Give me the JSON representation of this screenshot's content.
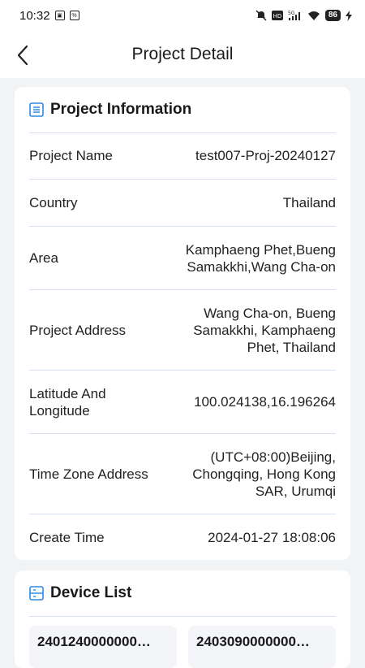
{
  "status_bar": {
    "time": "10:32",
    "battery": "86"
  },
  "header": {
    "title": "Project Detail"
  },
  "project_info": {
    "section_title": "Project Information",
    "rows": [
      {
        "label": "Project Name",
        "value": "test007-Proj-20240127"
      },
      {
        "label": "Country",
        "value": "Thailand"
      },
      {
        "label": "Area",
        "value": "Kamphaeng Phet,Bueng Samakkhi,Wang Cha-on"
      },
      {
        "label": "Project Address",
        "value": "Wang Cha-on, Bueng Samakkhi, Kamphaeng Phet, Thailand"
      },
      {
        "label": "Latitude And Longitude",
        "value": "100.024138,16.196264"
      },
      {
        "label": "Time Zone Address",
        "value": "(UTC+08:00)Beijing, Chongqing, Hong Kong SAR, Urumqi"
      },
      {
        "label": "Create Time",
        "value": "2024-01-27 18:08:06"
      }
    ]
  },
  "device_list": {
    "section_title": "Device List",
    "devices": [
      "2401240000000…",
      "2403090000000…"
    ]
  },
  "colors": {
    "accent": "#2e8ae6",
    "divider": "#d9e2f0",
    "background": "#f2f3f5"
  }
}
